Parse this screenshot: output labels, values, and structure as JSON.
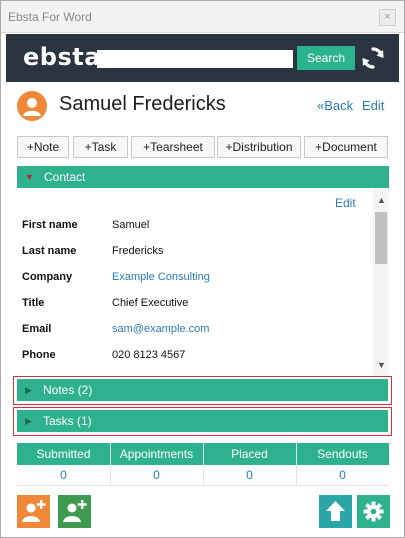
{
  "window": {
    "title": "Ebsta For Word",
    "close_glyph": "×"
  },
  "brand": {
    "logo_text": "ebsta",
    "search_placeholder": "",
    "search_button_label": "Search",
    "sync_icon": "sync-icon"
  },
  "header": {
    "name": "Samuel Fredericks",
    "back_label": "«Back",
    "edit_label": "Edit",
    "avatar_icon": "user-icon"
  },
  "actions": [
    "+Note",
    "+Task",
    "+Tearsheet",
    "+Distribution",
    "+Document"
  ],
  "contact": {
    "section_label": "Contact",
    "edit_label": "Edit",
    "fields": [
      {
        "label": "First name",
        "value": "Samuel"
      },
      {
        "label": "Last name",
        "value": "Fredericks"
      },
      {
        "label": "Company",
        "value": "Example Consulting"
      },
      {
        "label": "Title",
        "value": "Chief Executive"
      },
      {
        "label": "Email",
        "value": "sam@example.com"
      },
      {
        "label": "Phone",
        "value": "020 8123 4567"
      }
    ]
  },
  "sections": [
    {
      "label": "Notes (2)"
    },
    {
      "label": "Tasks (1)"
    }
  ],
  "stats": [
    {
      "label": "Submitted",
      "value": "0"
    },
    {
      "label": "Appointments",
      "value": "0"
    },
    {
      "label": "Placed",
      "value": "0"
    },
    {
      "label": "Sendouts",
      "value": "0"
    }
  ],
  "footer": {
    "buttons": [
      "add-contact-icon",
      "add-candidate-icon",
      "home-icon",
      "settings-icon"
    ]
  },
  "colors": {
    "accent_green": "#2db28d",
    "brand_dark": "#2b3542",
    "link_blue": "#2a7ab8",
    "avatar_orange": "#f0883a",
    "highlight_red": "#d0333b"
  }
}
